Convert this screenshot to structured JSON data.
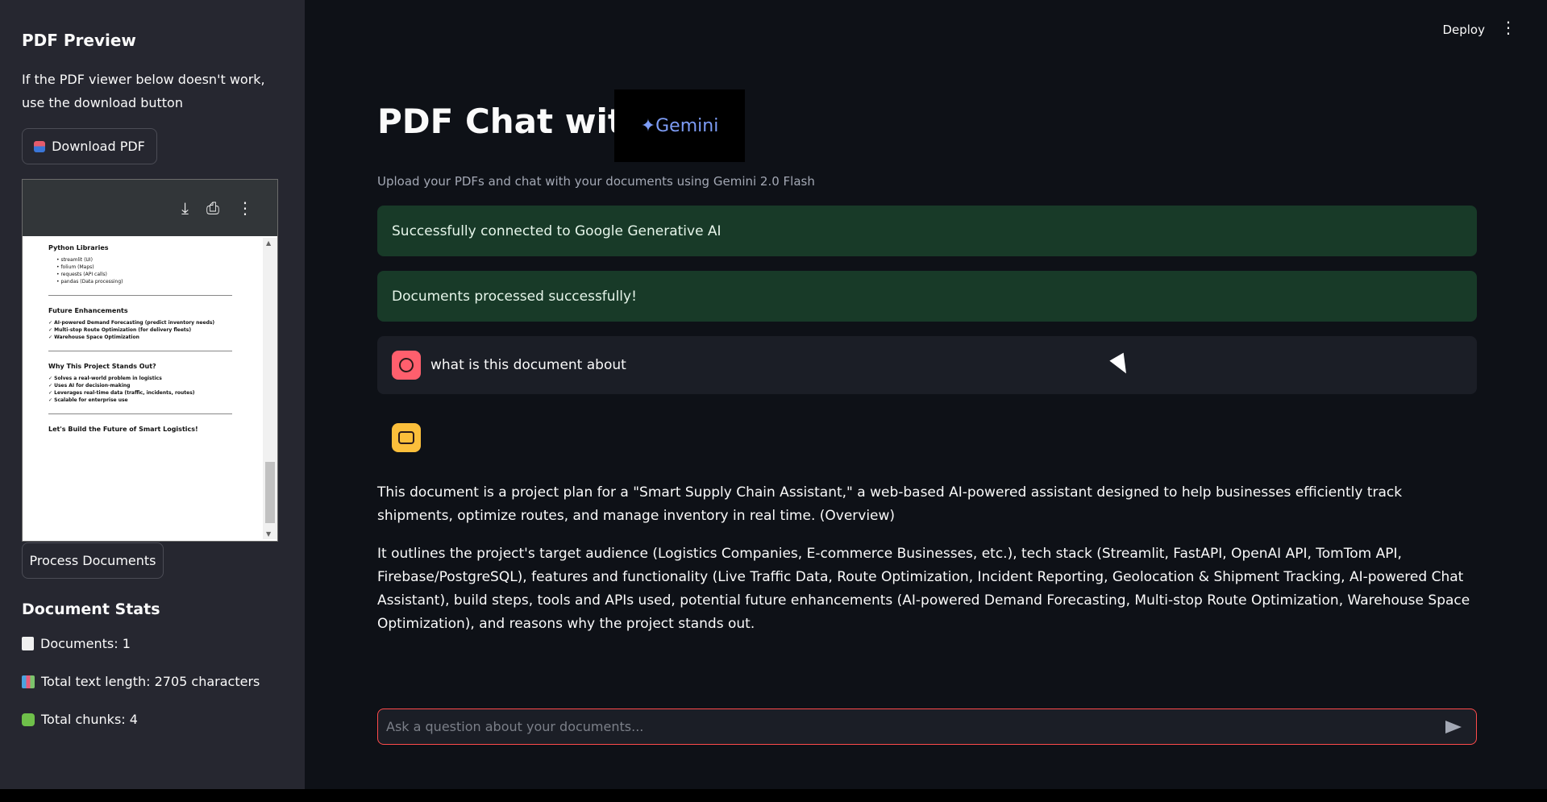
{
  "sidebar": {
    "title": "PDF Preview",
    "note": "If the PDF viewer below doesn't work, use the download button",
    "download_label": "Download PDF",
    "process_label": "Process Documents",
    "viewer": {
      "sections": [
        {
          "heading": "Python Libraries",
          "lines": [
            "• streamlit (UI)",
            "• folium (Maps)",
            "• requests (API calls)",
            "• pandas (Data processing)"
          ]
        },
        {
          "heading": "Future Enhancements",
          "lines": [
            "✓ AI-powered Demand Forecasting (predict inventory needs)",
            "✓ Multi-stop Route Optimization (for delivery fleets)",
            "✓ Warehouse Space Optimization"
          ]
        },
        {
          "heading": "Why This Project Stands Out?",
          "lines": [
            "✓ Solves a real-world problem in logistics",
            "✓ Uses AI for decision-making",
            "✓ Leverages real-time data (traffic, incidents, routes)",
            "✓ Scalable for enterprise use"
          ]
        },
        {
          "heading": "Let's Build the Future of Smart Logistics!",
          "lines": []
        }
      ]
    },
    "stats": {
      "title": "Document Stats",
      "documents": "Documents: 1",
      "length": "Total text length: 2705 characters",
      "chunks": "Total chunks: 4"
    }
  },
  "header": {
    "deploy_label": "Deploy"
  },
  "main": {
    "title": "PDF Chat with",
    "logo_text": "✦Gemini",
    "subtitle": "Upload your PDFs and chat with your documents using Gemini 2.0 Flash",
    "alerts": [
      "Successfully connected to Google Generative AI",
      "Documents processed successfully!"
    ],
    "user_message": "what is this document about",
    "answer": [
      "This document is a project plan for a \"Smart Supply Chain Assistant,\" a web-based AI-powered assistant designed to help businesses efficiently track shipments, optimize routes, and manage inventory in real time. (Overview)",
      "It outlines the project's target audience (Logistics Companies, E-commerce Businesses, etc.), tech stack (Streamlit, FastAPI, OpenAI API, TomTom API, Firebase/PostgreSQL), features and functionality (Live Traffic Data, Route Optimization, Incident Reporting, Geolocation & Shipment Tracking, AI-powered Chat Assistant), build steps, tools and APIs used, potential future enhancements (AI-powered Demand Forecasting, Multi-stop Route Optimization, Warehouse Space Optimization), and reasons why the project stands out."
    ],
    "chat_placeholder": "Ask a question about your documents..."
  },
  "colors": {
    "accent": "#ff4b4b",
    "success_bg": "#183a28",
    "sidebar_bg": "#262730",
    "main_bg": "#0e1117"
  }
}
